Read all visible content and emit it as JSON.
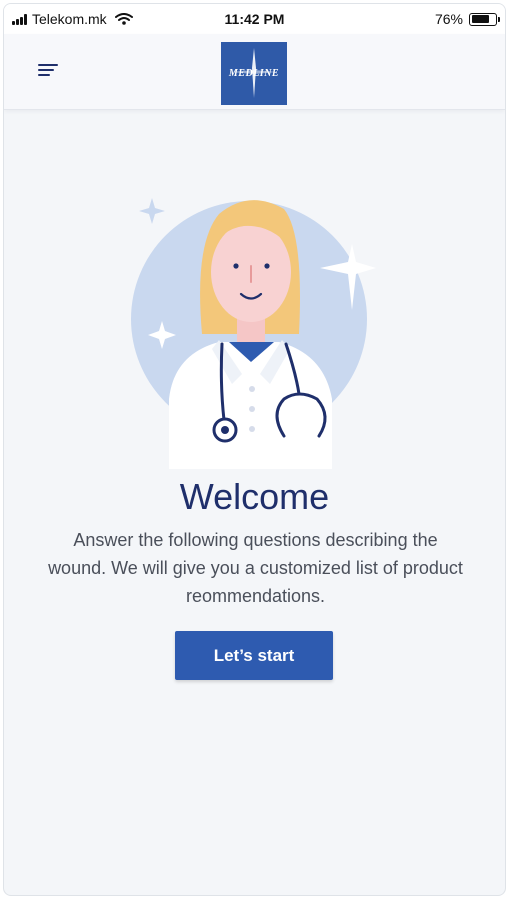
{
  "status_bar": {
    "carrier": "Telekom.mk",
    "time": "11:42 PM",
    "battery": "76%",
    "battery_level": 0.76
  },
  "header": {
    "menu_icon": "hamburger-menu-icon",
    "logo_text": "MEDLINE"
  },
  "welcome": {
    "title": "Welcome",
    "description": "Answer the following questions describing the wound. We will give you a customized list of  product reommendations.",
    "start_label": "Let’s start"
  },
  "colors": {
    "brand": "#2f5aa8",
    "title": "#1f2f6b",
    "button": "#2e5bb0",
    "background": "#f4f6f9"
  }
}
